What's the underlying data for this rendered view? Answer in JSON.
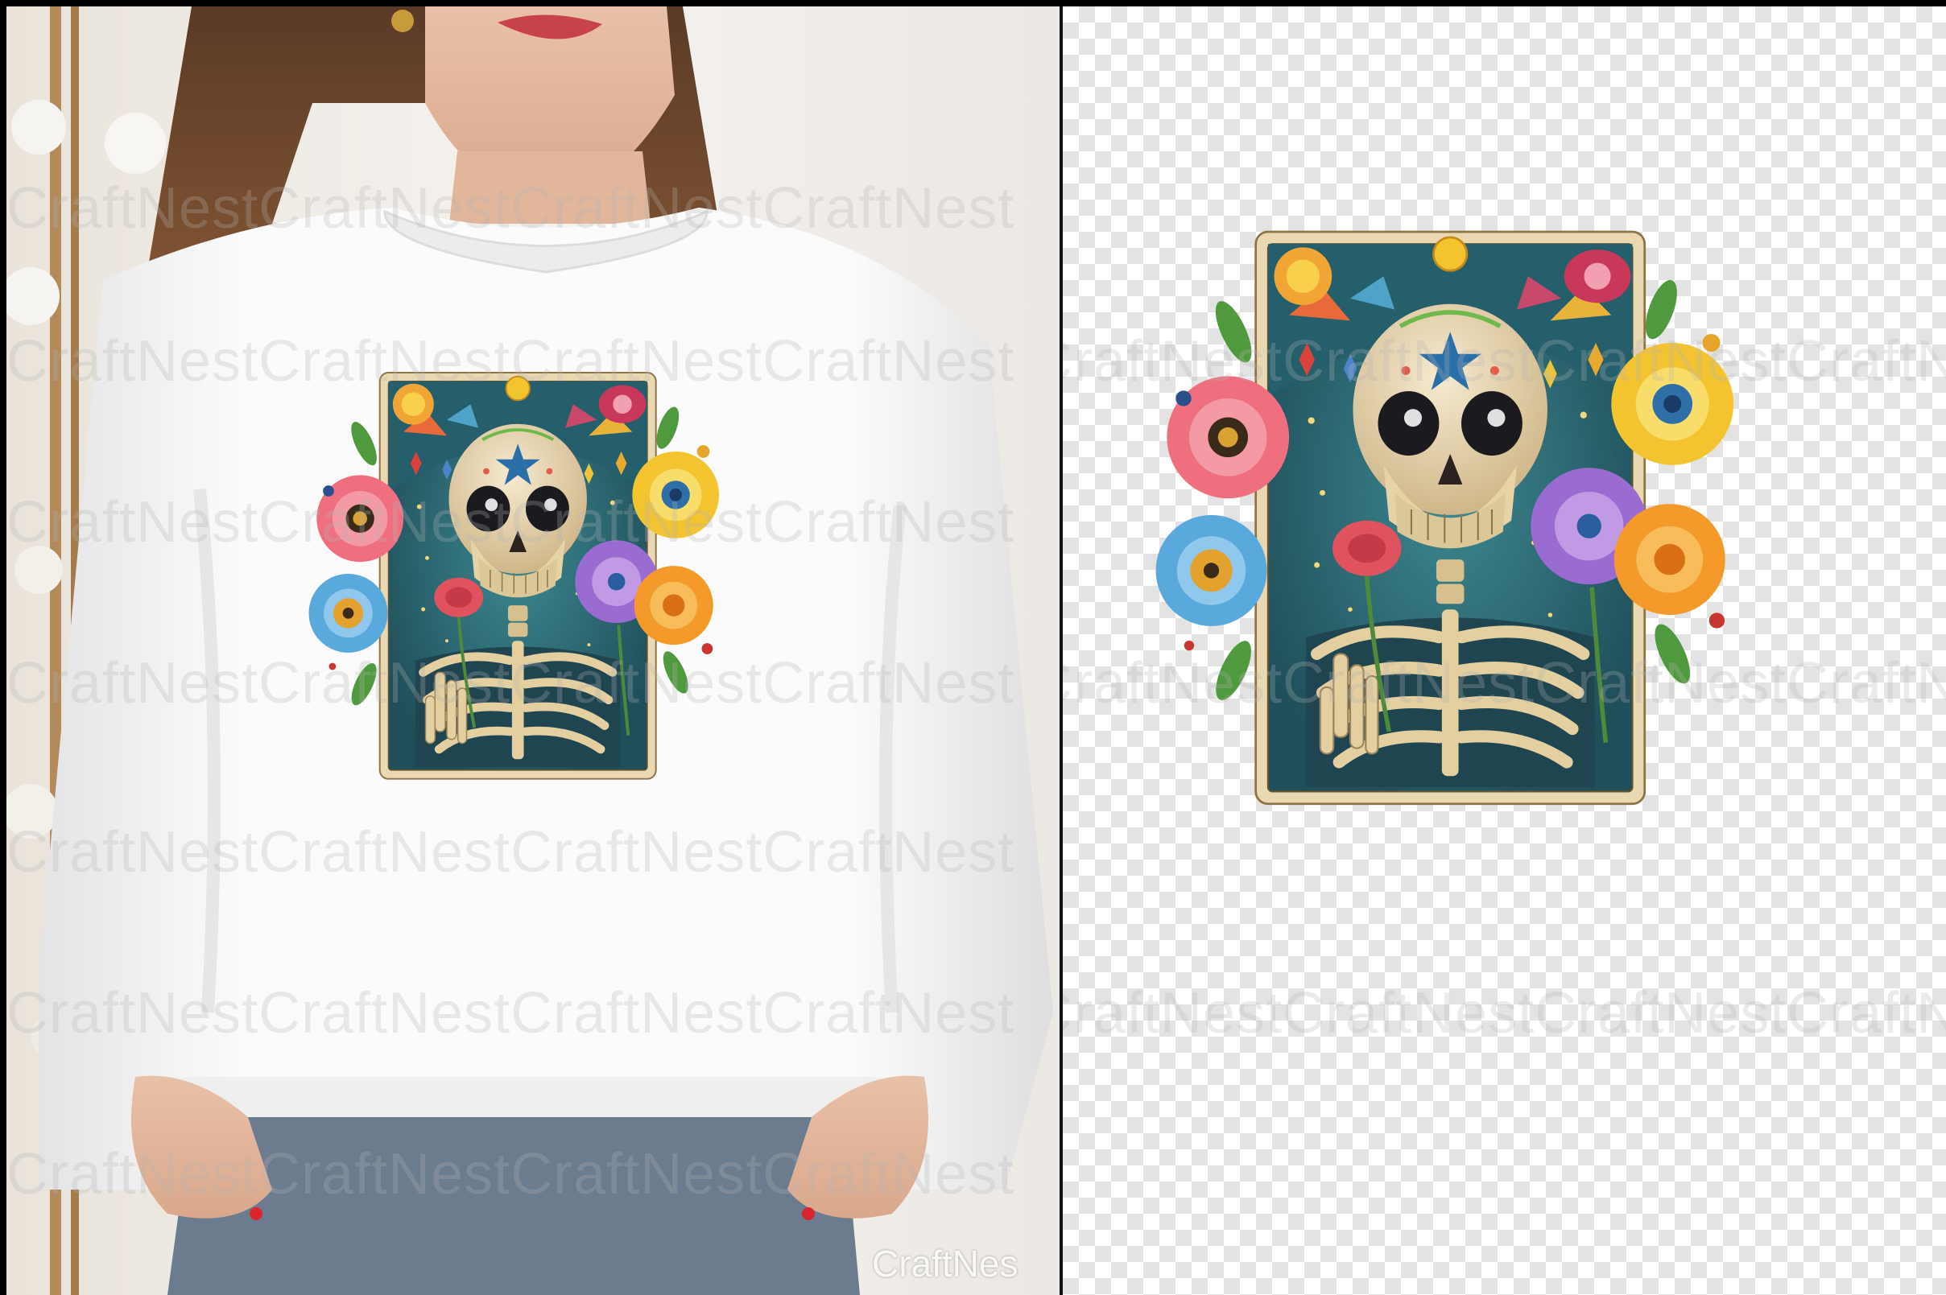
{
  "watermark": {
    "repeat_text": "CraftNestCraftNestCraftNestCraftNest",
    "corner_text": "CraftNes"
  },
  "colors": {
    "sweatshirt": "#fafafa",
    "wall": "#f3f1ee",
    "card_cream": "#ead9b0",
    "card_teal": "#2f6b74",
    "bone": "#e8d7ad",
    "flower_pink": "#ef6f7e",
    "flower_yellow": "#f4c430",
    "flower_blue": "#5aa9dd",
    "flower_purple": "#9a6bd0",
    "flower_orange": "#f49a2a"
  }
}
